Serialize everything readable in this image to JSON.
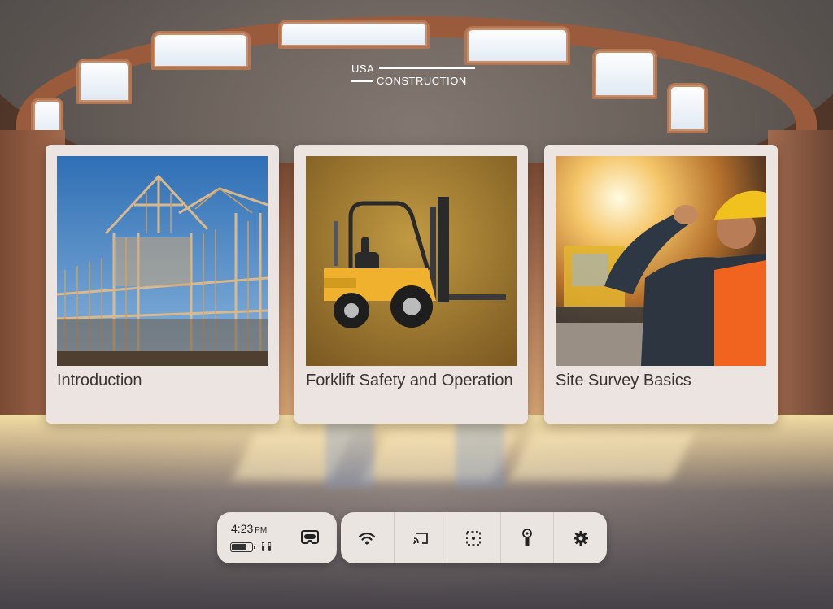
{
  "logo": {
    "line1": "USA",
    "line2": "CONSTRUCTION"
  },
  "cards": [
    {
      "title": "Introduction",
      "image": "house-framing-image"
    },
    {
      "title": "Forklift Safety and Operation",
      "image": "forklift-image"
    },
    {
      "title": "Site Survey Basics",
      "image": "construction-worker-image"
    }
  ],
  "taskbar": {
    "time": "4:23",
    "ampm": "PM",
    "icons": {
      "battery": "battery-icon",
      "controllers": "controllers-icon",
      "headset": "headset-icon",
      "wifi": "wifi-icon",
      "cast": "cast-icon",
      "boundary": "boundary-icon",
      "controller": "controller-icon",
      "settings": "settings-icon"
    }
  },
  "colors": {
    "card_bg": "#ebe4e0",
    "taskbar_bg": "#ebe5e1",
    "text": "#3a3532"
  }
}
